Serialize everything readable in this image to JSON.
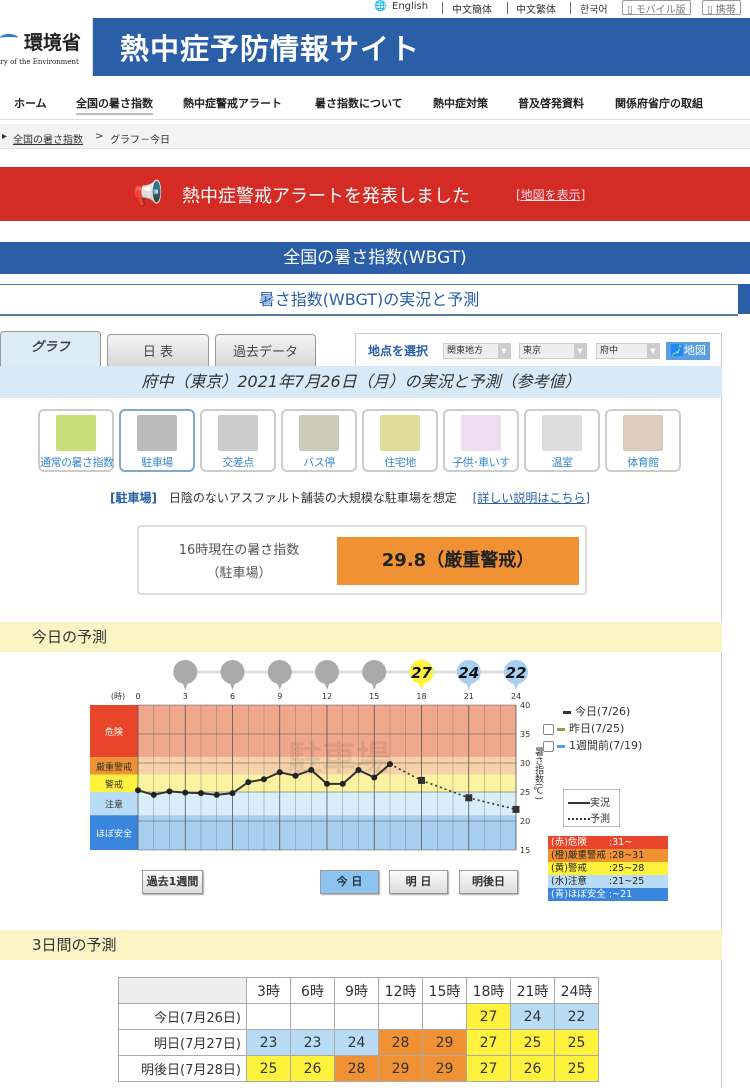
{
  "lang_bar": {
    "items": [
      "English",
      "中文簡体",
      "中文繁体",
      "한국어"
    ],
    "mobile": "モバイル版",
    "keitai": "携帯"
  },
  "header": {
    "logo_text": "環境省",
    "logo_sub": "Ministry of the Environment",
    "site_title": "熱中症予防情報サイト"
  },
  "nav": {
    "items": [
      "ホーム",
      "全国の暑さ指数",
      "熱中症警戒アラート",
      "暑さ指数について",
      "熱中症対策",
      "普及啓発資料",
      "関係府省庁の取組"
    ],
    "active": 1
  },
  "breadcrumb": {
    "link": "全国の暑さ指数",
    "sep": ">",
    "current": "グラフ－今日"
  },
  "alert": {
    "message": "熱中症警戒アラートを発表しました",
    "link": "[地図を表示]"
  },
  "section_title": "全国の暑さ指数(WBGT)",
  "sub_title": "暑さ指数(WBGT)の実況と予測",
  "tabs": [
    "グラフ",
    "日 表",
    "過去データ"
  ],
  "selector": {
    "label": "地点を選択",
    "region": "関東地方",
    "prefecture": "東京",
    "station": "府中",
    "map_button": "地図"
  },
  "date_title": "府中（東京）2021年7月26日（月）の実況と予測（参考値）",
  "place_types": [
    "通常の暑さ指数",
    "駐車場",
    "交差点",
    "バス停",
    "住宅地",
    "子供･車いす",
    "温室",
    "体育館"
  ],
  "place_active": 1,
  "description": {
    "tag": "[駐車場]",
    "text": "日陰のないアスファルト舗装の大規模な駐車場を想定",
    "link": "[詳しい説明はこちら]"
  },
  "current": {
    "label1": "16時現在の暑さ指数",
    "label2": "（駐車場）",
    "value": "29.8（厳重警戒）",
    "color": "#f09233"
  },
  "today_heading": "今日の予測",
  "three_day_heading": "3日間の予測",
  "chart_data": {
    "type": "line",
    "x_unit_label": "(時)",
    "x_ticks": [
      0,
      3,
      6,
      9,
      12,
      15,
      18,
      21,
      24
    ],
    "xlim": [
      0,
      24
    ],
    "ylim": [
      15,
      40
    ],
    "y_ticks": [
      15,
      20,
      25,
      30,
      35,
      40
    ],
    "ylabel": "暑さ指数(℃)",
    "grid": true,
    "watermark": "駐車場",
    "zones": [
      {
        "label": "危険",
        "min": 31,
        "max": 40,
        "color": "#f0a88c",
        "label_color": "#e8452a"
      },
      {
        "label": "厳重警戒",
        "min": 28,
        "max": 31,
        "color": "#f7d2a8",
        "label_color": "#f09233"
      },
      {
        "label": "警戒",
        "min": 25,
        "max": 28,
        "color": "#fbf3a0",
        "label_color": "#fff23d"
      },
      {
        "label": "注意",
        "min": 21,
        "max": 25,
        "color": "#d8effb",
        "label_color": "#b8dcf5"
      },
      {
        "label": "ほぼ安全",
        "min": 15,
        "max": 21,
        "color": "#a8cff0",
        "label_color": "#3a85dd"
      }
    ],
    "series": [
      {
        "name": "実況",
        "style": "solid",
        "x": [
          0,
          1,
          2,
          3,
          4,
          5,
          6,
          7,
          8,
          9,
          10,
          11,
          12,
          13,
          14,
          15,
          16
        ],
        "y": [
          25.3,
          24.5,
          25.1,
          24.9,
          24.8,
          24.5,
          24.8,
          26.7,
          27.2,
          28.4,
          27.8,
          28.8,
          26.4,
          26.4,
          28.8,
          27.5,
          29.8
        ]
      },
      {
        "name": "予測",
        "style": "dotted",
        "x": [
          16,
          18,
          21,
          24
        ],
        "y": [
          29.8,
          27,
          24,
          22
        ]
      }
    ],
    "bubbles": [
      {
        "hour": 3,
        "value": null
      },
      {
        "hour": 6,
        "value": null
      },
      {
        "hour": 9,
        "value": null
      },
      {
        "hour": 12,
        "value": null
      },
      {
        "hour": 15,
        "value": null
      },
      {
        "hour": 18,
        "value": "27",
        "color": "#fff23d"
      },
      {
        "hour": 21,
        "value": "24",
        "color": "#a8cff0"
      },
      {
        "hour": 24,
        "value": "22",
        "color": "#a8cff0"
      }
    ],
    "legend": {
      "today": "今日(7/26)",
      "yesterday": "昨日(7/25)",
      "week_ago": "1週間前(7/19)",
      "actual": "実況",
      "forecast": "予測"
    },
    "zone_key": [
      "(赤)危険　　 :31~",
      "(橙)厳重警戒 :28~31",
      "(黄)警戒　　 :25~28",
      "(水)注意　　 :21~25",
      "(青)ほぼ安全 :~21"
    ]
  },
  "chart_buttons": {
    "past_week": "過去1週間",
    "today": "今 日",
    "tomorrow": "明 日",
    "day_after": "明後日"
  },
  "forecast_table": {
    "headers": [
      "3時",
      "6時",
      "9時",
      "12時",
      "15時",
      "18時",
      "21時",
      "24時"
    ],
    "rows": [
      {
        "label": "今日(7月26日)",
        "values": [
          "",
          "",
          "",
          "",
          "",
          "27",
          "24",
          "22"
        ]
      },
      {
        "label": "明日(7月27日)",
        "values": [
          "23",
          "23",
          "24",
          "28",
          "29",
          "27",
          "25",
          "25"
        ]
      },
      {
        "label": "明後日(7月28日)",
        "values": [
          "25",
          "26",
          "28",
          "29",
          "29",
          "27",
          "26",
          "25"
        ]
      }
    ]
  }
}
